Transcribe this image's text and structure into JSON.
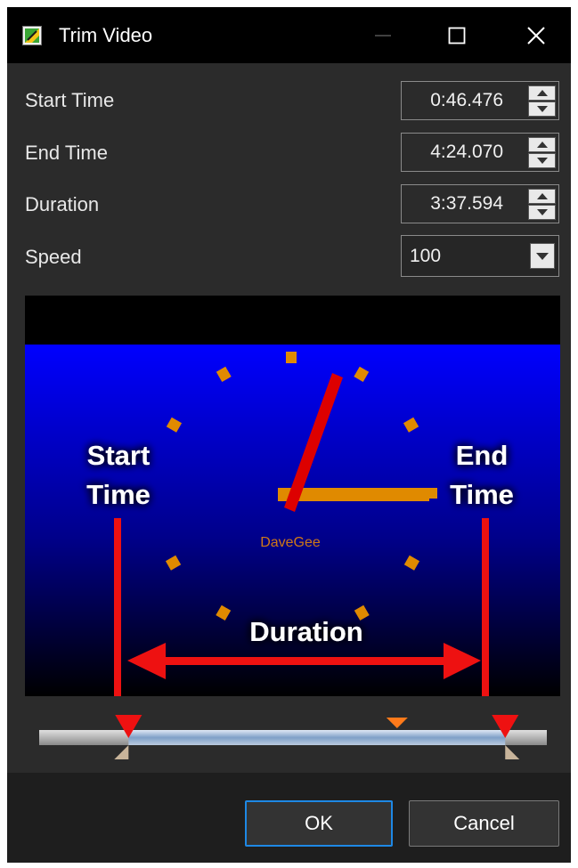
{
  "window": {
    "title": "Trim Video"
  },
  "fields": {
    "start_time": {
      "label": "Start Time",
      "value": "0:46.476"
    },
    "end_time": {
      "label": "End Time",
      "value": "4:24.070"
    },
    "duration": {
      "label": "Duration",
      "value": "3:37.594"
    },
    "speed": {
      "label": "Speed",
      "value": "100"
    }
  },
  "preview": {
    "watermark": "DaveGee",
    "annotations": {
      "start_line1": "Start",
      "start_line2": "Time",
      "end_line1": "End",
      "end_line2": "Time",
      "duration": "Duration"
    }
  },
  "timeline": {
    "start_fraction": 0.176,
    "end_fraction": 0.918,
    "playhead_fraction": 0.705
  },
  "buttons": {
    "ok": "OK",
    "cancel": "Cancel"
  },
  "colors": {
    "background": "#2b2b2b",
    "titlebar": "#000000",
    "arrow_red": "#ee1111",
    "clock_tick": "#e08a00",
    "accent_blue": "#1e88e5"
  },
  "icons": {
    "app": "app-icon",
    "minimize": "minimize-icon",
    "maximize": "maximize-icon",
    "close": "close-icon"
  }
}
